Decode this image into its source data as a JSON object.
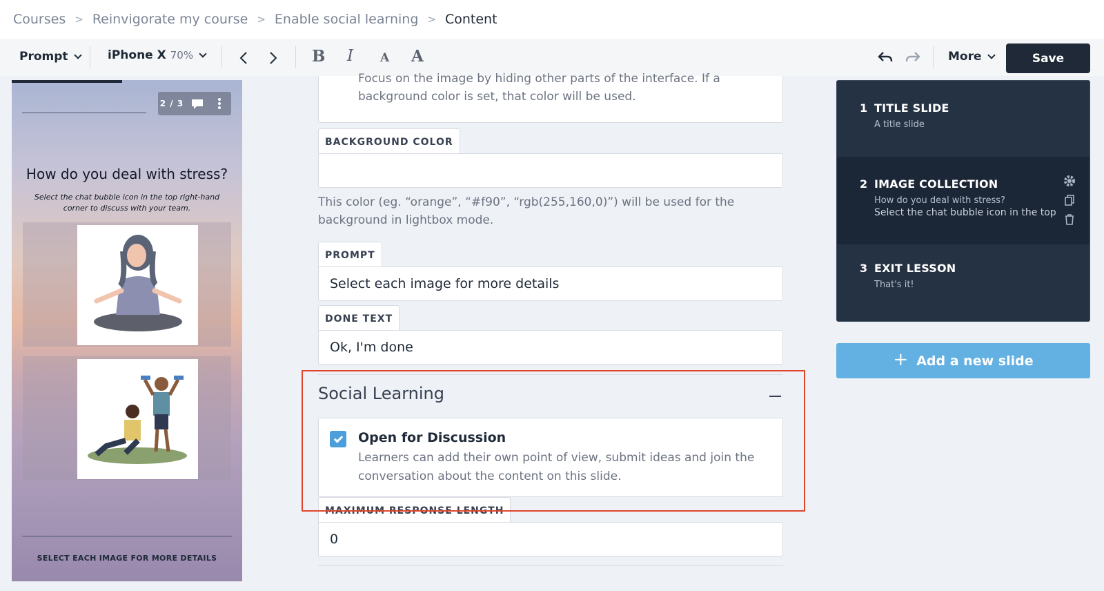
{
  "breadcrumb": {
    "items": [
      "Courses",
      "Reinvigorate my course",
      "Enable social learning"
    ],
    "current": "Content"
  },
  "toolbar": {
    "prompt_label": "Prompt",
    "device_label": "iPhone X",
    "zoom_level": "70%",
    "more_label": "More",
    "save_label": "Save",
    "format_buttons": {
      "bold": "B",
      "italic": "I",
      "small_font": "A",
      "large_font": "A"
    }
  },
  "preview": {
    "counter": "2 / 3",
    "progress": 0.48,
    "title": "How do you deal with stress?",
    "subtitle": "Select the chat bubble icon in the top right-hand corner to discuss with your team.",
    "footer": "SELECT EACH IMAGE FOR MORE DETAILS"
  },
  "form": {
    "lightbox_help_top": "Focus on the image by hiding other parts of the interface. If a background color is set, that color will be used.",
    "background_color": {
      "label": "BACKGROUND COLOR",
      "value": "",
      "help": "This color (eg. “orange”, “#f90”, “rgb(255,160,0)”) will be used for the background in lightbox mode."
    },
    "prompt": {
      "label": "PROMPT",
      "value": "Select each image for more details"
    },
    "done_text": {
      "label": "DONE TEXT",
      "value": "Ok, I'm done"
    },
    "social_learning": {
      "title": "Social Learning",
      "open_for_discussion": {
        "checked": true,
        "title": "Open for Discussion",
        "description": "Learners can add their own point of view, submit ideas and join the conversation about the content on this slide."
      }
    },
    "max_response": {
      "label": "MAXIMUM RESPONSE LENGTH",
      "value": "0"
    }
  },
  "slides": [
    {
      "number": "1",
      "title": "TITLE SLIDE",
      "subtitle": "A title slide"
    },
    {
      "number": "2",
      "title": "IMAGE COLLECTION",
      "subtitle": "How do you deal with stress?",
      "subtitle2": "Select the chat bubble icon in the top"
    },
    {
      "number": "3",
      "title": "EXIT LESSON",
      "subtitle": "That's it!"
    }
  ],
  "add_slide_label": "Add a new slide",
  "colors": {
    "accent": "#63b0e3",
    "checkbox": "#4d9fdc",
    "highlight": "#e0452c",
    "save_button": "#1f2937",
    "slide_panel": "#253244"
  },
  "icons": [
    "chevron-right-icon",
    "chevron-down-icon",
    "arrow-left-icon",
    "arrow-right-icon",
    "undo-icon",
    "redo-icon",
    "chat-bubble-icon",
    "more-vertical-icon",
    "gear-icon",
    "copy-icon",
    "trash-icon",
    "plus-icon",
    "checkmark-icon",
    "minus-icon"
  ]
}
